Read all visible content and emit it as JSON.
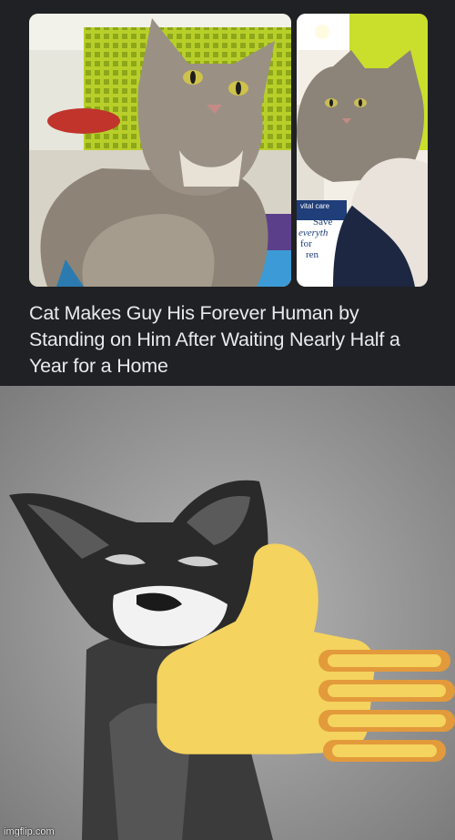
{
  "article": {
    "headline": "Cat Makes Guy His Forever Human by Standing on Him After Waiting Nearly Half a Year for a Home",
    "store_sign_lines": [
      "vital care",
      "Save",
      "everyth",
      "for",
      "ren"
    ]
  },
  "meme": {
    "subject": "thumbs-up cat",
    "watermark": "imgflip.com"
  },
  "colors": {
    "page_background": "#202124",
    "headline_text": "#e8eaed",
    "thumb_yellow": "#f4d35e",
    "thumb_orange": "#e39a3b",
    "meme_background": "#a6a6a6"
  }
}
